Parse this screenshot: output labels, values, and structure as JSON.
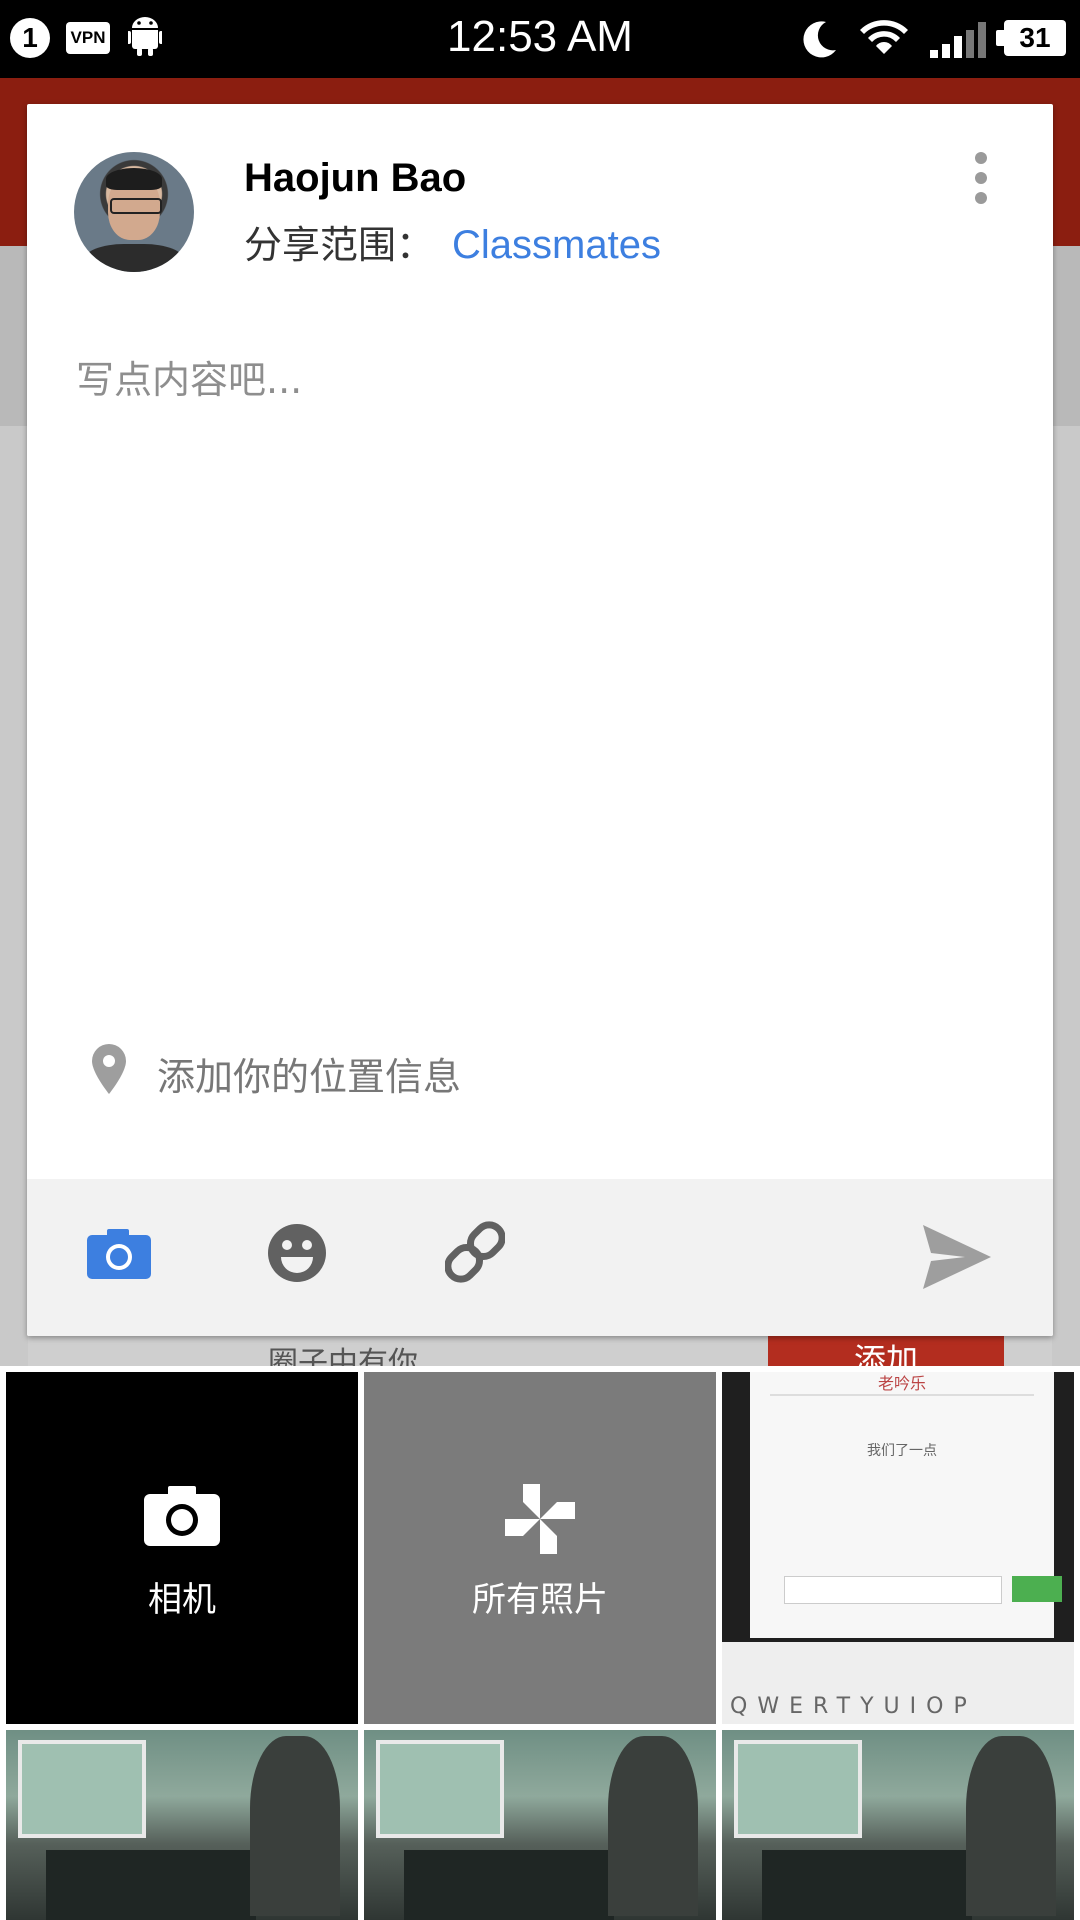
{
  "status_bar": {
    "notification_count": "1",
    "vpn_label": "VPN",
    "time": "12:53 AM",
    "battery": "31",
    "icons": [
      "android-icon",
      "moon-icon",
      "wifi-icon",
      "signal-icon",
      "battery-icon"
    ]
  },
  "post": {
    "user_name": "Haojun Bao",
    "share_label": "分享范围：",
    "share_target": "Classmates",
    "compose_placeholder": "写点内容吧...",
    "location_label": "添加你的位置信息",
    "accent_color": "#3d7fe0"
  },
  "toolbar": {
    "icons": [
      "camera-icon",
      "emoji-icon",
      "link-icon",
      "send-icon"
    ]
  },
  "background": {
    "strip_text": "圈子中有你",
    "strip_button": "添加"
  },
  "picker": {
    "camera_label": "相机",
    "all_photos_label": "所有照片",
    "screenshot_title": "老吟乐",
    "screenshot_text": "我们了一点",
    "screenshot_keys": "QWERTYUIOP"
  }
}
